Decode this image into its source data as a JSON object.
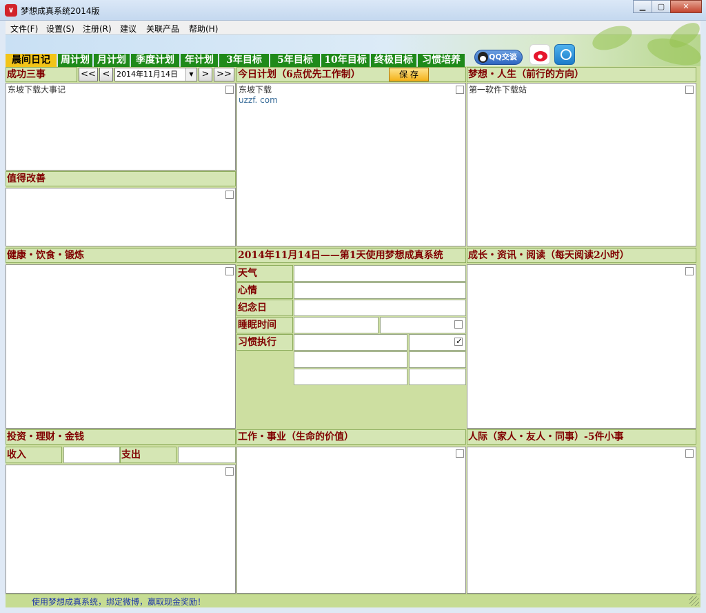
{
  "window": {
    "title": "梦想成真系统2014版",
    "minimize": "▁",
    "maximize": "▢",
    "close": "✕"
  },
  "menu": [
    "文件(F)",
    "设置(S)",
    "注册(R)",
    "建议",
    "关联产品",
    "帮助(H)"
  ],
  "tabs": [
    "晨间日记",
    "周计划",
    "月计划",
    "季度计划",
    "年计划",
    "3年目标",
    "5年目标",
    "10年目标",
    "终极目标",
    "习惯培养"
  ],
  "active_tab": "晨间日记",
  "toolbar": {
    "qq_label": "QQ交谈",
    "weibo_icon": "weibo-icon",
    "tqq_icon": "tencent-weibo-icon"
  },
  "success": {
    "title": "成功三事",
    "nav_first": "<<",
    "nav_prev": "<",
    "nav_next": ">",
    "nav_last": ">>",
    "date": "2014年11月14日",
    "text": "东坡下载大事记"
  },
  "today_plan": {
    "title": "今日计划（6点优先工作制）",
    "save_label": "保 存",
    "line1": "东坡下载",
    "line2": "uzzf. com"
  },
  "dream": {
    "title": "梦想・人生（前行的方向）",
    "text": "第一软件下载站"
  },
  "improve": {
    "title": "值得改善"
  },
  "health": {
    "title": "健康・饮食・锻炼"
  },
  "diary": {
    "title": "2014年11月14日——第1天使用梦想成真系统",
    "weather_label": "天气",
    "mood_label": "心情",
    "anniversary_label": "纪念日",
    "sleep_label": "睡眠时间",
    "habit_label": "习惯执行",
    "habit_checked": true
  },
  "growth": {
    "title": "成长・资讯・阅读（每天阅读2小时）"
  },
  "finance": {
    "title": "投资・理财・金钱",
    "income_label": "收入",
    "expense_label": "支出"
  },
  "work": {
    "title": "工作・事业（生命的价值）"
  },
  "relations": {
    "title": "人际（家人・友人・同事）-5件小事"
  },
  "status": {
    "text": "使用梦想成真系统，绑定微博，赢取现金奖励！"
  },
  "colors": {
    "header_text": "#800000",
    "panel_bg": "#d5e6b4",
    "tab_bg": "#1f8a1a",
    "tab_active": "#f2c418",
    "status_text": "#1a33a8"
  }
}
